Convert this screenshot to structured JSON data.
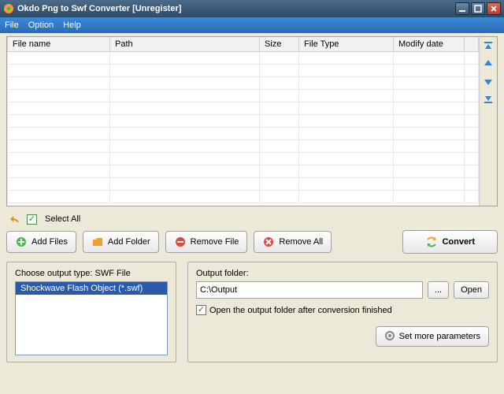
{
  "window": {
    "title": "Okdo Png to Swf Converter [Unregister]"
  },
  "menu": {
    "file": "File",
    "option": "Option",
    "help": "Help"
  },
  "grid": {
    "columns": {
      "name": "File name",
      "path": "Path",
      "size": "Size",
      "type": "File Type",
      "modify": "Modify date"
    }
  },
  "toolbar": {
    "select_all": "Select All",
    "add_files": "Add Files",
    "add_folder": "Add Folder",
    "remove_file": "Remove File",
    "remove_all": "Remove All",
    "convert": "Convert"
  },
  "output_type": {
    "label": "Choose output type:  SWF File",
    "items": [
      "Shockwave Flash Object (*.swf)"
    ]
  },
  "output_folder": {
    "label": "Output folder:",
    "value": "C:\\Output",
    "browse": "...",
    "open": "Open",
    "open_after": "Open the output folder after conversion finished"
  },
  "more_params": "Set more parameters"
}
